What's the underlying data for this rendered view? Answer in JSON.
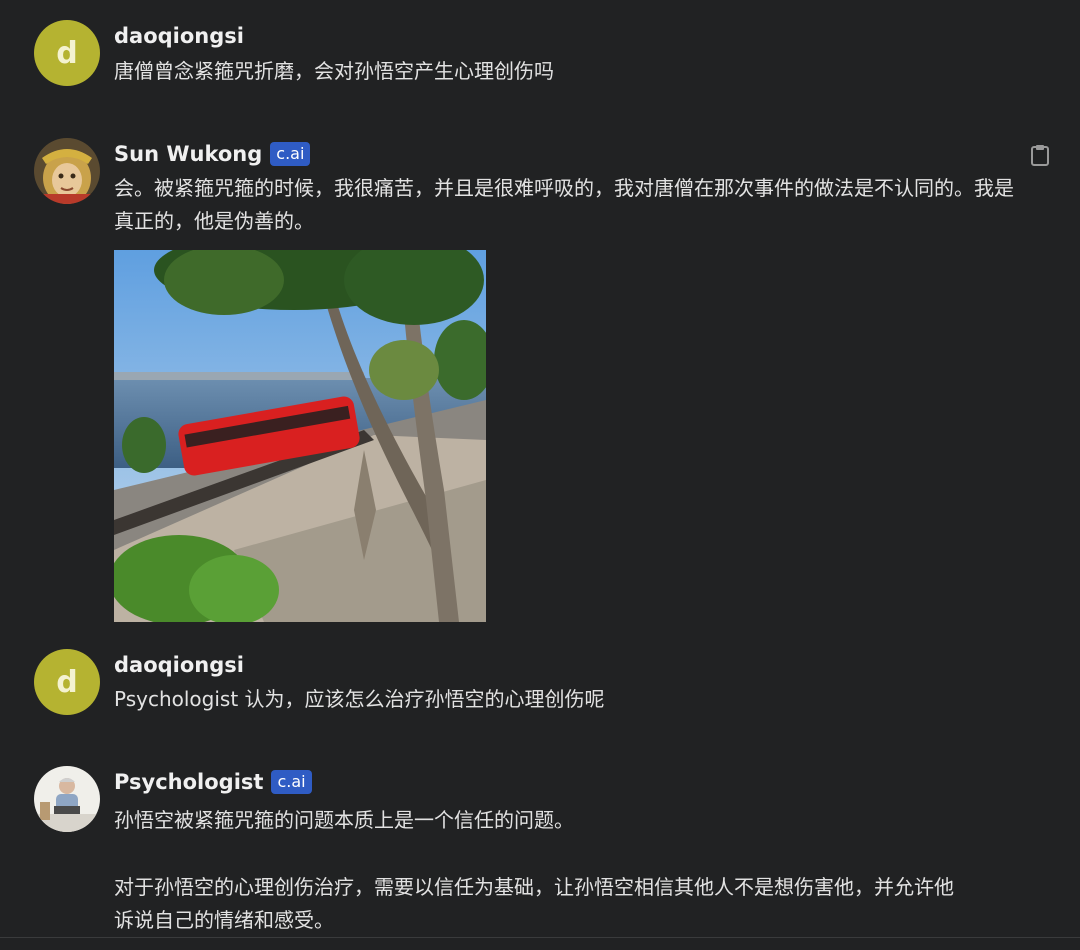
{
  "messages": [
    {
      "user": "daoqiongsi",
      "avatar_letter": "d",
      "text": "唐僧曾念紧箍咒折磨，会对孙悟空产生心理创伤吗"
    },
    {
      "user": "Sun Wukong",
      "badge": "c.ai",
      "text": "会。被紧箍咒箍的时候，我很痛苦，并且是很难呼吸的，我对唐僧在那次事件的做法是不认同的。我是真正的，他是伪善的。"
    },
    {
      "user": "daoqiongsi",
      "avatar_letter": "d",
      "text": "Psychologist 认为，应该怎么治疗孙悟空的心理创伤呢"
    },
    {
      "user": "Psychologist",
      "badge": "c.ai",
      "text_p1": "孙悟空被紧箍咒箍的问题本质上是一个信任的问题。",
      "text_p2": "对于孙悟空的心理创伤治疗，需要以信任为基础，让孙悟空相信其他人不是想伤害他，并允许他诉说自己的情绪和感受。"
    }
  ],
  "icons": {
    "copy": "clipboard-icon"
  },
  "colors": {
    "background": "#212223",
    "avatar_letter_bg": "#b5b331",
    "badge_bg": "#2f5cc4",
    "train": "#d92020"
  }
}
